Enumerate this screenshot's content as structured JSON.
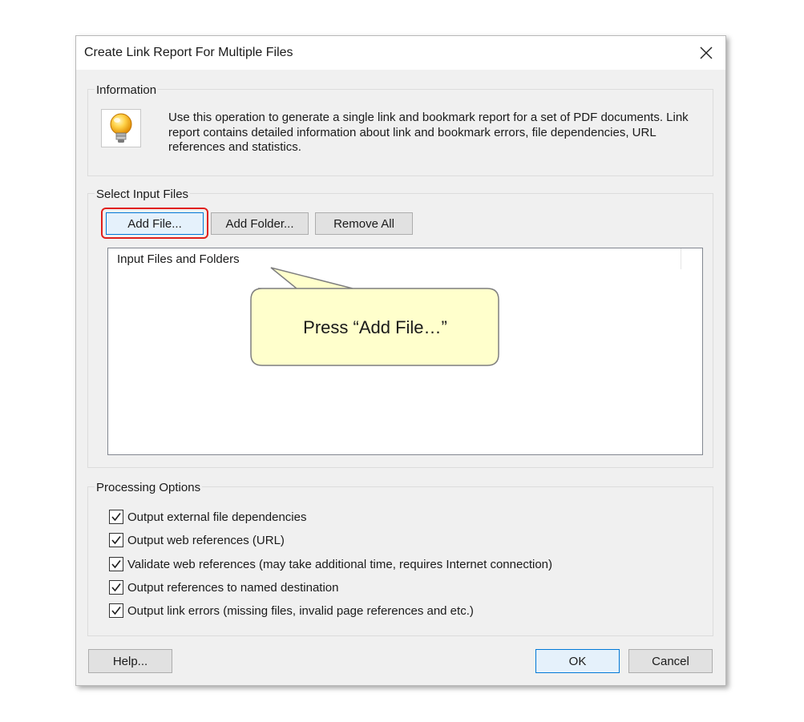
{
  "dialog": {
    "title": "Create Link Report For Multiple Files",
    "close_icon": "close-icon"
  },
  "information": {
    "label": "Information",
    "icon": "lightbulb-icon",
    "text": "Use this operation to generate a single link and bookmark report for a set of PDF documents. Link report contains detailed information about link and bookmark errors, file dependencies, URL references and statistics."
  },
  "input_files": {
    "label": "Select Input Files",
    "add_file_label": "Add File...",
    "add_folder_label": "Add Folder...",
    "remove_all_label": "Remove All",
    "list_column_header": "Input Files and Folders",
    "items": []
  },
  "callout": {
    "text": "Press “Add File…”",
    "fill_color": "#ffffcc",
    "border_color": "#7f7f7f"
  },
  "processing_options": {
    "label": "Processing Options",
    "options": [
      {
        "label": "Output external file dependencies",
        "checked": true
      },
      {
        "label": "Output web references (URL)",
        "checked": true
      },
      {
        "label": "Validate web references (may take additional time, requires Internet connection)",
        "checked": true
      },
      {
        "label": "Output references to named destination",
        "checked": true
      },
      {
        "label": "Output link errors (missing files, invalid page references and etc.)",
        "checked": true
      }
    ]
  },
  "footer": {
    "help_label": "Help...",
    "ok_label": "OK",
    "cancel_label": "Cancel"
  },
  "colors": {
    "highlight_ring": "#e0201c",
    "focus_border": "#0078d7",
    "dialog_bg": "#f0f0f0"
  }
}
